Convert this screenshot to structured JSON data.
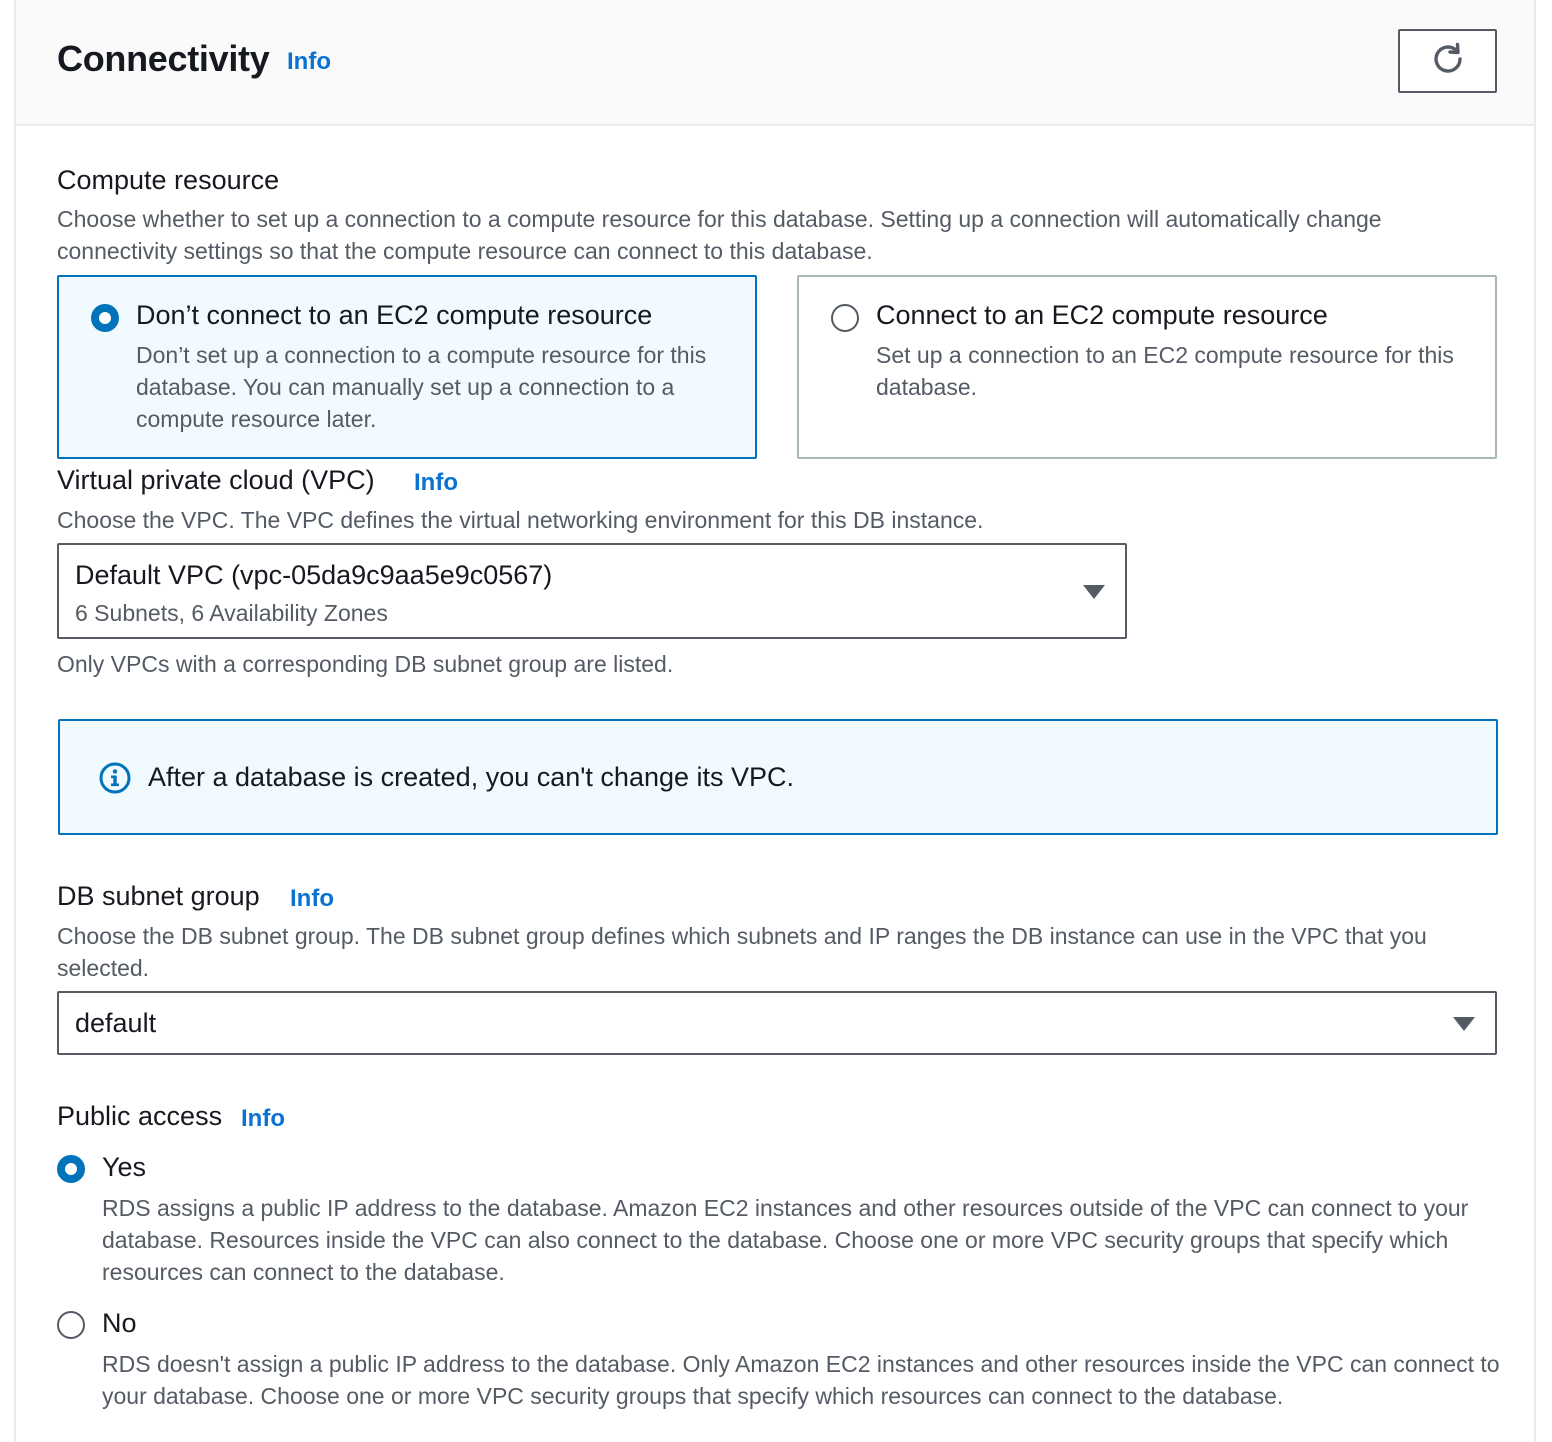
{
  "header": {
    "title": "Connectivity",
    "info_label": "Info",
    "refresh_icon": "refresh-icon"
  },
  "compute_resource": {
    "label": "Compute resource",
    "description": "Choose whether to set up a connection to a compute resource for this database. Setting up a connection will automatically change connectivity settings so that the compute resource can connect to this database.",
    "options": [
      {
        "title": "Don’t connect to an EC2 compute resource",
        "description": "Don’t set up a connection to a compute resource for this database. You can manually set up a connection to a compute resource later.",
        "selected": true
      },
      {
        "title": "Connect to an EC2 compute resource",
        "description": "Set up a connection to an EC2 compute resource for this database.",
        "selected": false
      }
    ]
  },
  "vpc": {
    "label": "Virtual private cloud (VPC)",
    "info_label": "Info",
    "description": "Choose the VPC. The VPC defines the virtual networking environment for this DB instance.",
    "selected_value": "Default VPC (vpc-05da9c9aa5e9c0567)",
    "selected_subtext": "6 Subnets, 6 Availability Zones",
    "hint": "Only VPCs with a corresponding DB subnet group are listed."
  },
  "alert": {
    "text": "After a database is created, you can't change its VPC.",
    "icon": "info-circle-icon"
  },
  "subnet_group": {
    "label": "DB subnet group",
    "info_label": "Info",
    "description": "Choose the DB subnet group. The DB subnet group defines which subnets and IP ranges the DB instance can use in the VPC that you selected.",
    "selected_value": "default"
  },
  "public_access": {
    "label": "Public access",
    "info_label": "Info",
    "options": [
      {
        "title": "Yes",
        "description": "RDS assigns a public IP address to the database. Amazon EC2 instances and other resources outside of the VPC can connect to your database. Resources inside the VPC can also connect to the database. Choose one or more VPC security groups that specify which resources can connect to the database.",
        "selected": true
      },
      {
        "title": "No",
        "description": "RDS doesn't assign a public IP address to the database. Only Amazon EC2 instances and other resources inside the VPC can connect to your database. Choose one or more VPC security groups that specify which resources can connect to the database.",
        "selected": false
      }
    ]
  },
  "colors": {
    "accent": "#0073bb",
    "link": "#0972d3",
    "selected_bg": "#f1faff",
    "text": "#16191f",
    "muted": "#545b64"
  }
}
